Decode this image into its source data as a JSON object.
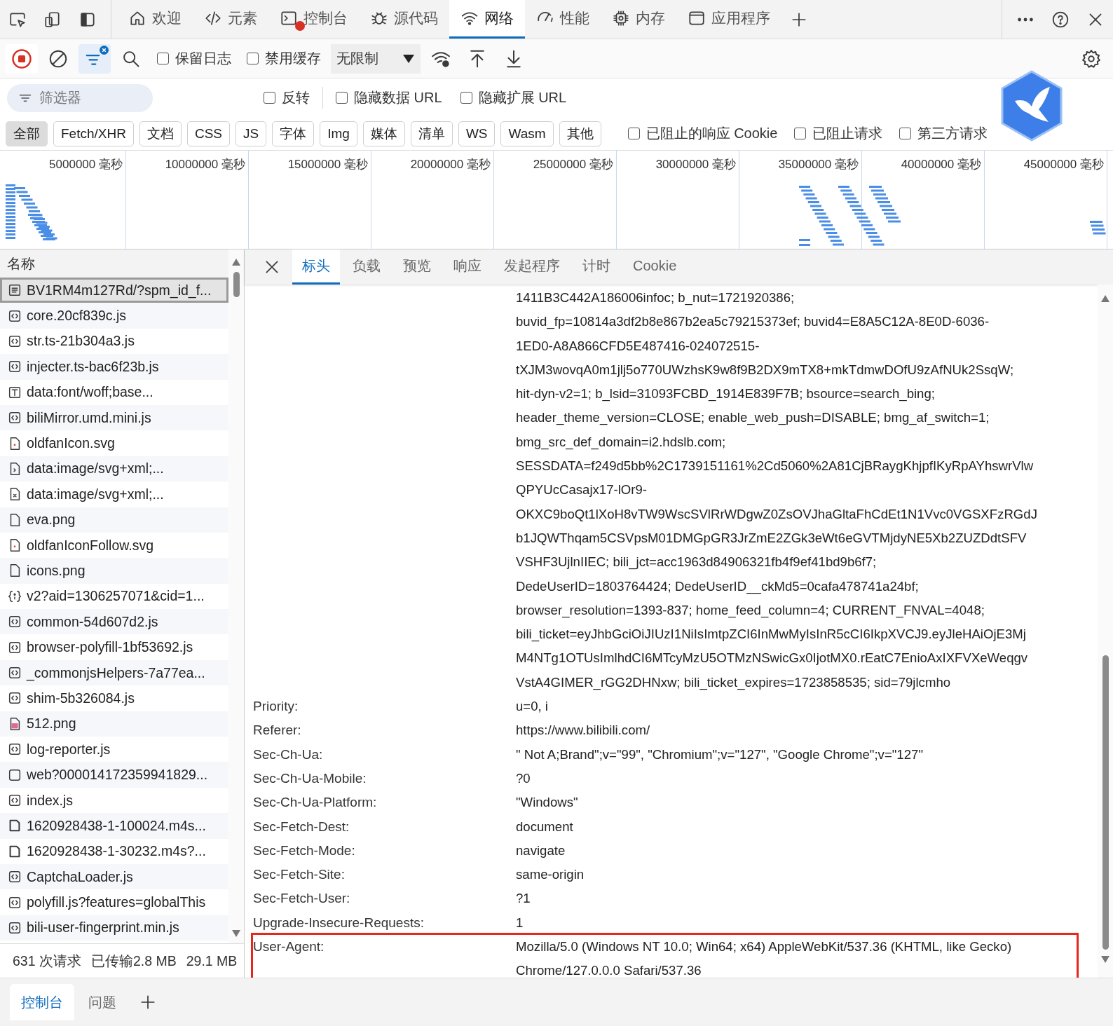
{
  "main_tabs": [
    {
      "label": "欢迎",
      "kind": "home",
      "selected": false,
      "has_error": false
    },
    {
      "label": "元素",
      "kind": "code",
      "selected": false,
      "has_error": false
    },
    {
      "label": "控制台",
      "kind": "console",
      "selected": false,
      "has_error": true
    },
    {
      "label": "源代码",
      "kind": "bug",
      "selected": false,
      "has_error": false
    },
    {
      "label": "网络",
      "kind": "wifi",
      "selected": true,
      "has_error": false
    },
    {
      "label": "性能",
      "kind": "gauge",
      "selected": false,
      "has_error": false
    },
    {
      "label": "内存",
      "kind": "chip",
      "selected": false,
      "has_error": false
    },
    {
      "label": "应用程序",
      "kind": "window",
      "selected": false,
      "has_error": false
    }
  ],
  "network_toolbar": {
    "recording": true,
    "filter_active": true,
    "checkboxes": [
      {
        "label": "保留日志",
        "checked": false
      },
      {
        "label": "禁用缓存",
        "checked": false
      }
    ],
    "throttling": "无限制"
  },
  "filter_bar": {
    "placeholder": "筛选器",
    "checkboxes": [
      {
        "label": "反转",
        "checked": false
      },
      {
        "label": "隐藏数据 URL",
        "checked": false
      },
      {
        "label": "隐藏扩展 URL",
        "checked": false
      }
    ]
  },
  "type_filters": [
    {
      "label": "全部",
      "selected": true
    },
    {
      "label": "Fetch/XHR",
      "selected": false
    },
    {
      "label": "文档",
      "selected": false
    },
    {
      "label": "CSS",
      "selected": false
    },
    {
      "label": "JS",
      "selected": false
    },
    {
      "label": "字体",
      "selected": false
    },
    {
      "label": "Img",
      "selected": false
    },
    {
      "label": "媒体",
      "selected": false
    },
    {
      "label": "清单",
      "selected": false
    },
    {
      "label": "WS",
      "selected": false
    },
    {
      "label": "Wasm",
      "selected": false
    },
    {
      "label": "其他",
      "selected": false
    }
  ],
  "type_checkboxes": [
    {
      "label": "已阻止的响应 Cookie",
      "checked": false
    },
    {
      "label": "已阻止请求",
      "checked": false
    },
    {
      "label": "第三方请求",
      "checked": false
    }
  ],
  "overview": {
    "ticks": [
      "5000000 毫秒",
      "10000000 毫秒",
      "15000000 毫秒",
      "20000000 毫秒",
      "25000000 毫秒",
      "30000000 毫秒",
      "35000000 毫秒",
      "40000000 毫秒",
      "45000000 毫秒"
    ]
  },
  "requests": {
    "column": "名称",
    "rows": [
      {
        "name": "BV1RM4m127Rd/?spm_id_f...",
        "kind": "document",
        "selected": true
      },
      {
        "name": "core.20cf839c.js",
        "kind": "script",
        "selected": false
      },
      {
        "name": "str.ts-21b304a3.js",
        "kind": "script",
        "selected": false
      },
      {
        "name": "injecter.ts-bac6f23b.js",
        "kind": "script",
        "selected": false
      },
      {
        "name": "data:font/woff;base...",
        "kind": "font",
        "selected": false
      },
      {
        "name": "biliMirror.umd.mini.js",
        "kind": "script",
        "selected": false
      },
      {
        "name": "oldfanIcon.svg",
        "kind": "svg",
        "selected": false
      },
      {
        "name": "data:image/svg+xml;...",
        "kind": "svg-arrow",
        "selected": false
      },
      {
        "name": "data:image/svg+xml;...",
        "kind": "svg-cross",
        "selected": false
      },
      {
        "name": "eva.png",
        "kind": "image",
        "selected": false
      },
      {
        "name": "oldfanIconFollow.svg",
        "kind": "svg",
        "selected": false
      },
      {
        "name": "icons.png",
        "kind": "image",
        "selected": false
      },
      {
        "name": "v2?aid=1306257071&cid=1...",
        "kind": "fetch",
        "selected": false
      },
      {
        "name": "common-54d607d2.js",
        "kind": "script",
        "selected": false
      },
      {
        "name": "browser-polyfill-1bf53692.js",
        "kind": "script",
        "selected": false
      },
      {
        "name": "_commonjsHelpers-7a77ea...",
        "kind": "script",
        "selected": false
      },
      {
        "name": "shim-5b326084.js",
        "kind": "script",
        "selected": false
      },
      {
        "name": "512.png",
        "kind": "photo",
        "selected": false
      },
      {
        "name": "log-reporter.js",
        "kind": "script",
        "selected": false
      },
      {
        "name": "web?000014172359941829...",
        "kind": "other",
        "selected": false
      },
      {
        "name": "index.js",
        "kind": "script",
        "selected": false
      },
      {
        "name": "1620928438-1-100024.m4s...",
        "kind": "media",
        "selected": false
      },
      {
        "name": "1620928438-1-30232.m4s?...",
        "kind": "media",
        "selected": false
      },
      {
        "name": "CaptchaLoader.js",
        "kind": "script",
        "selected": false
      },
      {
        "name": "polyfill.js?features=globalThis",
        "kind": "script",
        "selected": false
      },
      {
        "name": "bili-user-fingerprint.min.js",
        "kind": "script",
        "selected": false
      }
    ]
  },
  "summary": {
    "requests": "631 次请求",
    "transferred": "已传输2.8 MB",
    "resources": "29.1 MB"
  },
  "details": {
    "tabs": [
      {
        "label": "标头",
        "selected": true
      },
      {
        "label": "负载",
        "selected": false
      },
      {
        "label": "预览",
        "selected": false
      },
      {
        "label": "响应",
        "selected": false
      },
      {
        "label": "发起程序",
        "selected": false
      },
      {
        "label": "计时",
        "selected": false
      },
      {
        "label": "Cookie",
        "selected": false
      }
    ],
    "continued_value_lines": [
      "1411B3C442A186006infoc; b_nut=1721920386;",
      "buvid_fp=10814a3df2b8e867b2ea5c79215373ef; buvid4=E8A5C12A-8E0D-6036-",
      "1ED0-A8A866CFD5E487416-024072515-",
      "tXJM3wovqA0m1jlj5o770UWzhsK9w8f9B2DX9mTX8+mkTdmwDOfU9zAfNUk2SsqW;",
      "hit-dyn-v2=1; b_lsid=31093FCBD_1914E839F7B; bsource=search_bing;",
      "header_theme_version=CLOSE; enable_web_push=DISABLE; bmg_af_switch=1;",
      "bmg_src_def_domain=i2.hdslb.com;",
      "SESSDATA=f249d5bb%2C1739151161%2Cd5060%2A81CjBRaygKhjpfIKyRpAYhswrVlw",
      "QPYUcCasajx17-lOr9-",
      "OKXC9boQt1lXoH8vTW9WscSVlRrWDgwZ0ZsOVJhaGltaFhCdEt1N1Vvc0VGSXFzRGdJ",
      "b1JQWThqam5CSVpsM01DMGpGR3JrZmE2ZGk3eWt6eGVTMjdyNE5Xb2ZUZDdtSFV",
      "VSHF3UjlnIIEC; bili_jct=acc1963d84906321fb4f9ef41bd9b6f7;",
      "DedeUserID=1803764424; DedeUserID__ckMd5=0cafa478741a24bf;",
      "browser_resolution=1393-837; home_feed_column=4; CURRENT_FNVAL=4048;",
      "bili_ticket=eyJhbGciOiJIUzI1NiIsImtpZCI6InMwMyIsInR5cCI6IkpXVCJ9.eyJleHAiOjE3Mj",
      "M4NTg1OTUsImlhdCI6MTcyMzU5OTMzNSwicGx0IjotMX0.rEatC7EnioAxIXFVXeWeqgv",
      "VstA4GIMER_rGG2DHNxw; bili_ticket_expires=1723858535; sid=79jlcmho"
    ],
    "headers": [
      {
        "name": "Priority:",
        "value_lines": [
          "u=0, i"
        ],
        "highlighted": false
      },
      {
        "name": "Referer:",
        "value_lines": [
          "https://www.bilibili.com/"
        ],
        "highlighted": false
      },
      {
        "name": "Sec-Ch-Ua:",
        "value_lines": [
          "\" Not A;Brand\";v=\"99\", \"Chromium\";v=\"127\", \"Google Chrome\";v=\"127\""
        ],
        "highlighted": false
      },
      {
        "name": "Sec-Ch-Ua-Mobile:",
        "value_lines": [
          "?0"
        ],
        "highlighted": false
      },
      {
        "name": "Sec-Ch-Ua-Platform:",
        "value_lines": [
          "\"Windows\""
        ],
        "highlighted": false
      },
      {
        "name": "Sec-Fetch-Dest:",
        "value_lines": [
          "document"
        ],
        "highlighted": false
      },
      {
        "name": "Sec-Fetch-Mode:",
        "value_lines": [
          "navigate"
        ],
        "highlighted": false
      },
      {
        "name": "Sec-Fetch-Site:",
        "value_lines": [
          "same-origin"
        ],
        "highlighted": false
      },
      {
        "name": "Sec-Fetch-User:",
        "value_lines": [
          "?1"
        ],
        "highlighted": false
      },
      {
        "name": "Upgrade-Insecure-Requests:",
        "value_lines": [
          "1"
        ],
        "highlighted": false
      },
      {
        "name": "User-Agent:",
        "value_lines": [
          "Mozilla/5.0 (Windows NT 10.0; Win64; x64) AppleWebKit/537.36 (KHTML, like Gecko)",
          "Chrome/127.0.0.0 Safari/537.36"
        ],
        "highlighted": true
      }
    ]
  },
  "drawer": {
    "tabs": [
      {
        "label": "控制台",
        "selected": true
      },
      {
        "label": "问题",
        "selected": false
      }
    ]
  }
}
